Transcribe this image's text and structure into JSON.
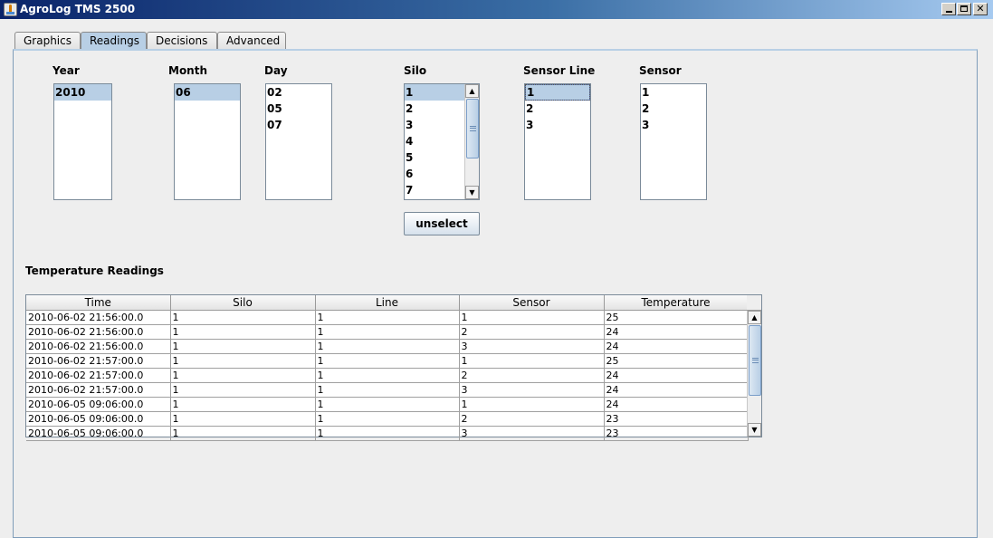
{
  "window": {
    "title": "AgroLog TMS 2500"
  },
  "tabs": [
    {
      "label": "Graphics"
    },
    {
      "label": "Readings"
    },
    {
      "label": "Decisions"
    },
    {
      "label": "Advanced"
    }
  ],
  "filters": {
    "year": {
      "label": "Year",
      "items": [
        "2010"
      ],
      "selected": "2010"
    },
    "month": {
      "label": "Month",
      "items": [
        "06"
      ],
      "selected": "06"
    },
    "day": {
      "label": "Day",
      "items": [
        "02",
        "05",
        "07"
      ]
    },
    "silo": {
      "label": "Silo",
      "items": [
        "1",
        "2",
        "3",
        "4",
        "5",
        "6",
        "7"
      ],
      "selected": "1"
    },
    "sensor_line": {
      "label": "Sensor Line",
      "items": [
        "1",
        "2",
        "3"
      ],
      "selected": "1"
    },
    "sensor": {
      "label": "Sensor",
      "items": [
        "1",
        "2",
        "3"
      ]
    }
  },
  "unselect_label": "unselect",
  "readings": {
    "title": "Temperature Readings",
    "columns": [
      "Time",
      "Silo",
      "Line",
      "Sensor",
      "Temperature"
    ],
    "rows": [
      [
        "2010-06-02 21:56:00.0",
        "1",
        "1",
        "1",
        "25"
      ],
      [
        "2010-06-02 21:56:00.0",
        "1",
        "1",
        "2",
        "24"
      ],
      [
        "2010-06-02 21:56:00.0",
        "1",
        "1",
        "3",
        "24"
      ],
      [
        "2010-06-02 21:57:00.0",
        "1",
        "1",
        "1",
        "25"
      ],
      [
        "2010-06-02 21:57:00.0",
        "1",
        "1",
        "2",
        "24"
      ],
      [
        "2010-06-02 21:57:00.0",
        "1",
        "1",
        "3",
        "24"
      ],
      [
        "2010-06-05 09:06:00.0",
        "1",
        "1",
        "1",
        "24"
      ],
      [
        "2010-06-05 09:06:00.0",
        "1",
        "1",
        "2",
        "23"
      ],
      [
        "2010-06-05 09:06:00.0",
        "1",
        "1",
        "3",
        "23"
      ]
    ]
  }
}
